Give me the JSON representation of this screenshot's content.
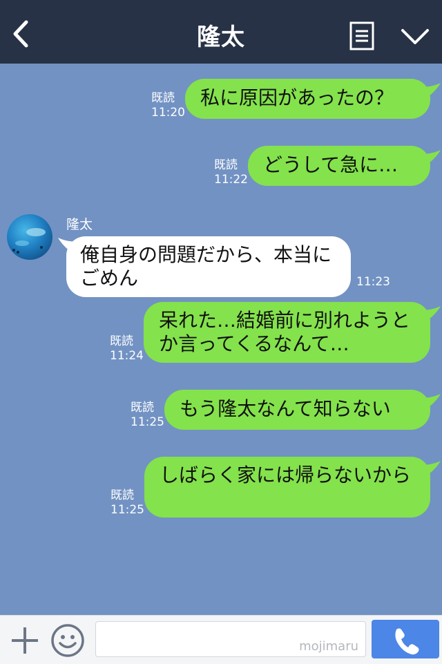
{
  "header": {
    "title": "隆太",
    "back_icon": "chevron-left-icon",
    "menu_icon": "document-menu-icon",
    "dropdown_icon": "chevron-down-icon"
  },
  "contact": {
    "name": "隆太",
    "avatar": "ocean-fish-avatar"
  },
  "messages": [
    {
      "from": "me",
      "text": "私に原因があったの？",
      "read": "既読",
      "time": "11:20"
    },
    {
      "from": "me",
      "text": "どうして急に…",
      "read": "既読",
      "time": "11:22"
    },
    {
      "from": "other",
      "text": "俺自身の問題だから、本当にごめん",
      "time": "11:23"
    },
    {
      "from": "me",
      "text": "呆れた…結婚前に別れようとか言ってくるなんて…",
      "read": "既読",
      "time": "11:24"
    },
    {
      "from": "me",
      "text": "もう隆太なんて知らない",
      "read": "既読",
      "time": "11:25"
    },
    {
      "from": "me",
      "text": "しばらく家には帰らないから",
      "read": "既読",
      "time": "11:25"
    }
  ],
  "footer": {
    "watermark": "mojimaru",
    "plus_icon": "plus-icon",
    "emoji_icon": "smiley-icon",
    "call_icon": "phone-icon"
  },
  "colors": {
    "header_bg": "#273246",
    "chat_bg": "#7292c3",
    "my_bubble": "#84e24c",
    "other_bubble": "#ffffff",
    "call_button": "#4c86e6"
  }
}
